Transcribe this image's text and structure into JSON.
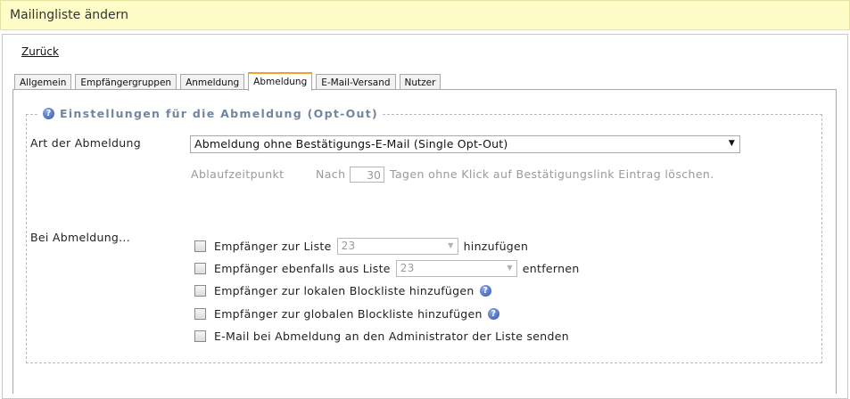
{
  "header": {
    "title": "Mailingliste ändern"
  },
  "back_link": "Zurück",
  "tabs": [
    {
      "label": "Allgemein",
      "active": false
    },
    {
      "label": "Empfängergruppen",
      "active": false
    },
    {
      "label": "Anmeldung",
      "active": false
    },
    {
      "label": "Abmeldung",
      "active": true
    },
    {
      "label": "E-Mail-Versand",
      "active": false
    },
    {
      "label": "Nutzer",
      "active": false
    }
  ],
  "section": {
    "legend": "Einstellungen für die Abmeldung (Opt-Out)",
    "legend_icon": "help-icon"
  },
  "unsubscribe_type": {
    "label": "Art der Abmeldung",
    "value": "Abmeldung ohne Bestätigungs-E-Mail (Single Opt-Out)"
  },
  "expiry": {
    "label": "Ablaufzeitpunkt",
    "prefix": "Nach",
    "days": "30",
    "suffix": "Tagen ohne Klick auf Bestätigungslink Eintrag löschen."
  },
  "on_unsubscribe": {
    "label": "Bei Abmeldung...",
    "options": [
      {
        "text": "Empfänger zur Liste",
        "select_value": "23",
        "after": "hinzufügen",
        "checked": false
      },
      {
        "text": "Empfänger ebenfalls aus Liste",
        "select_value": "23",
        "after": "entfernen",
        "checked": false
      },
      {
        "text": "Empfänger zur lokalen Blockliste hinzufügen",
        "help": true,
        "checked": false
      },
      {
        "text": "Empfänger zur globalen Blockliste hinzufügen",
        "help": true,
        "checked": false
      },
      {
        "text": "E-Mail bei Abmeldung an den Administrator der Liste senden",
        "checked": false
      }
    ]
  },
  "colors": {
    "header_bg": "#fefdc8",
    "active_tab_accent": "#f2a227",
    "legend_text": "#7286a0",
    "help_icon": "#2f55b0"
  }
}
